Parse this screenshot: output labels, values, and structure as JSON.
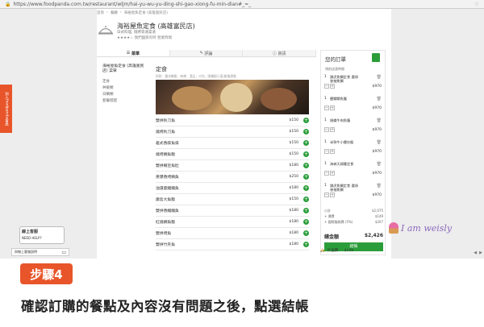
{
  "browser": {
    "url": "https://www.foodpanda.com.tw/restaurant/wljm/hai-yu-wu-yu-ding-shi-gao-xiong-fu-min-dian#_=_"
  },
  "breadcrumb": [
    "首頁",
    "餐廳",
    "海裕屋魚定食 (高雄富民店)"
  ],
  "shop": {
    "name": "海裕屋魚定食 (高雄富民店)",
    "sub": "日式料理, 燒烤等速渠道",
    "rating": "★★★★☆ 我們國家有時 營業時間"
  },
  "tabs": [
    "菜單",
    "評論",
    "資訊"
  ],
  "side": {
    "title": "海裕屋魚定食 (高雄富民店) 菜單",
    "items": [
      "定食",
      "丼飯類",
      "日鯛類",
      "套餐搭配"
    ]
  },
  "category": {
    "title": "定食",
    "desc": "所附：豐沛御飯、味噌、湯品，沙拉，隨機配小菜/飯後甜點"
  },
  "menu": [
    {
      "name": "雙拼秋刀魚",
      "price": "$150"
    },
    {
      "name": "燒烤秋刀魚",
      "price": "$150"
    },
    {
      "name": "義式香蒜魚排",
      "price": "$150"
    },
    {
      "name": "燒烤鯛魚腹",
      "price": "$150"
    },
    {
      "name": "雙拼鯖豆魚肚",
      "price": "$180"
    },
    {
      "name": "蔥爆香烤鯖魚",
      "price": "$250"
    },
    {
      "name": "油漬鹿鰻鰻魚",
      "price": "$180"
    },
    {
      "name": "廣島大魚腹",
      "price": "$150"
    },
    {
      "name": "雙拼香鰻鰻魚",
      "price": "$180"
    },
    {
      "name": "紅燒鯛魚腹",
      "price": "$180"
    },
    {
      "name": "雙拼烤魚",
      "price": "$180"
    },
    {
      "name": "雙拼竹夾魚",
      "price": "$180"
    }
  ],
  "cart": {
    "title": "您的訂單",
    "mode": "預前送達時間",
    "items": [
      {
        "qty": "1",
        "name": "讚虎魚鯛定食 選項 香柚焦鯛",
        "price": "$970"
      },
      {
        "qty": "1",
        "name": "鹽鯖鯖魚腹",
        "price": "$970"
      },
      {
        "qty": "1",
        "name": "燒蝶牛肉魚腹",
        "price": "$970"
      },
      {
        "qty": "1",
        "name": "半熟牛小櫻炒飯",
        "price": "$970"
      },
      {
        "qty": "1",
        "name": "海峽天婦羅定食",
        "price": "$970"
      },
      {
        "qty": "1",
        "name": "讚虎魚鯛定食 選項 香柚焦鯛",
        "price": "$970"
      }
    ],
    "sums": [
      {
        "label": "小計",
        "value": "$2,075"
      },
      {
        "label": "+ 運費",
        "value": "$149"
      },
      {
        "label": "+ 國際服務費 (5%)",
        "value": "$207"
      }
    ],
    "total_label": "總金額",
    "total_value": "$2,426",
    "checkout": "結帳",
    "min_label": "外送費：",
    "min_value": "$149"
  },
  "side_tab": "加入foodpanda會員",
  "help": {
    "title": "線上客服",
    "sub": "NEED HELP?",
    "bar": "與線上客服說明"
  },
  "watermark": "I am weisly",
  "step": "步驟4",
  "caption": "確認訂購的餐點及內容沒有問題之後，點選結帳"
}
